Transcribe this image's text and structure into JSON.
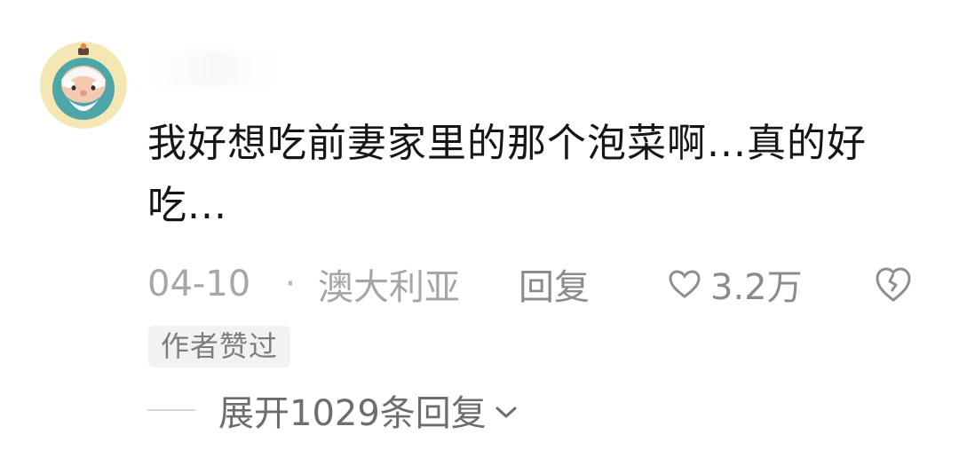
{
  "comment": {
    "avatar_icon": "old-man-avatar-icon",
    "username": "",
    "text": "我好想吃前妻家里的那个泡菜啊...真的好吃...",
    "date": "04-10",
    "separator": "·",
    "location": "澳大利亚",
    "reply_label": "回复",
    "like_icon": "heart-outline-icon",
    "like_count": "3.2万",
    "dislike_icon": "broken-heart-icon",
    "author_badge": "作者赞过",
    "expand_replies_label": "展开1029条回复",
    "expand_icon": "chevron-down-icon"
  },
  "colors": {
    "text_primary": "#161616",
    "text_secondary": "#a6a6a6",
    "badge_bg": "#f2f2f2",
    "avatar_bg": "#f4e7b3",
    "avatar_inner": "#4fa6a8"
  }
}
